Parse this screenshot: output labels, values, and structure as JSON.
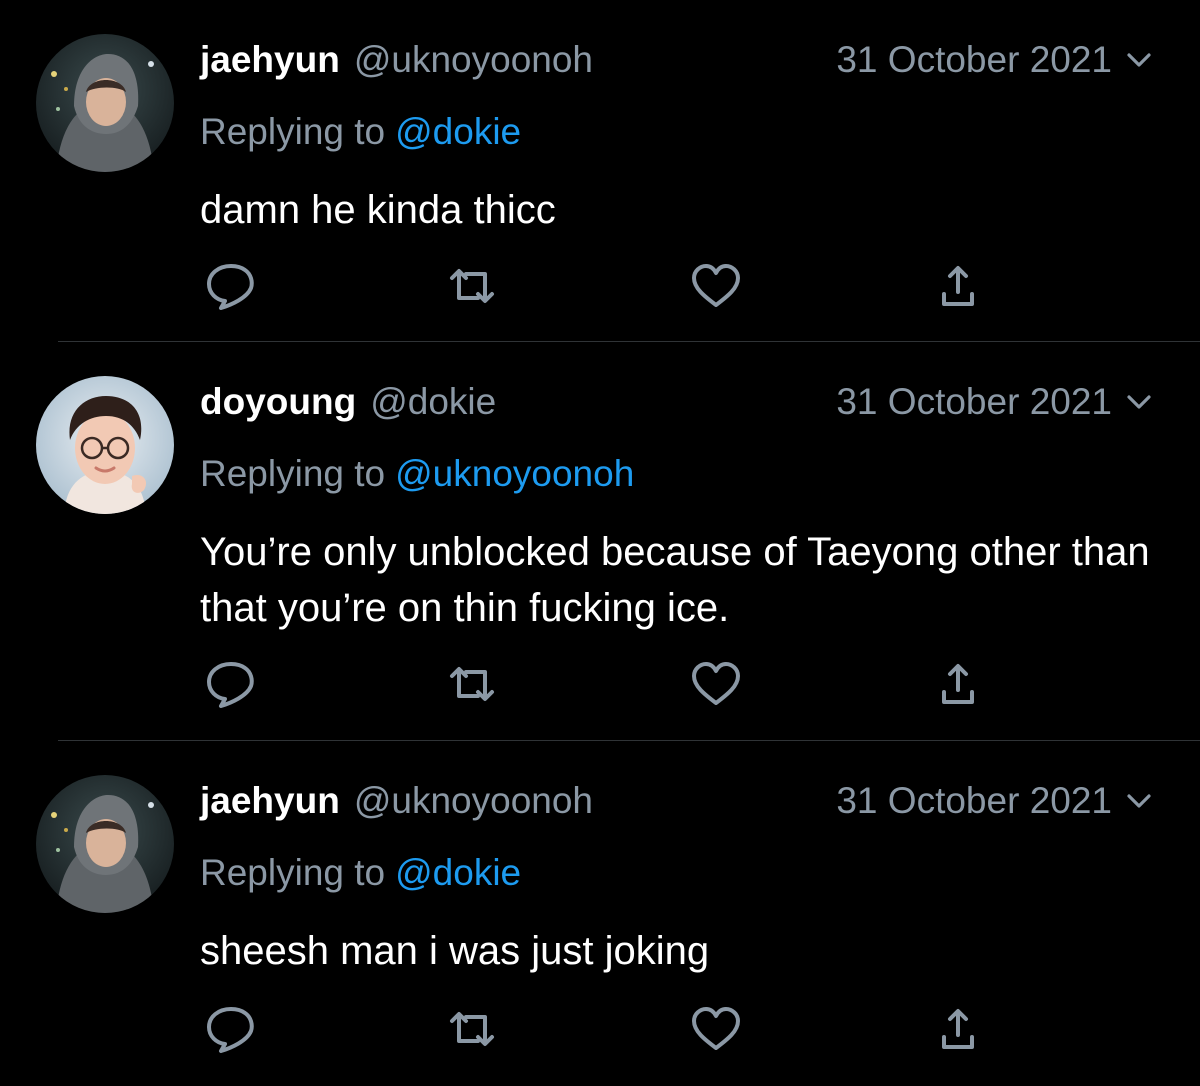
{
  "tweets": [
    {
      "display_name": "jaehyun",
      "handle": "@uknoyoonoh",
      "date": "31 October 2021",
      "reply_prefix": "Replying to",
      "reply_target": "@dokie",
      "text": "damn he kinda thicc",
      "avatar": "profile-photo-hooded"
    },
    {
      "display_name": "doyoung",
      "handle": "@dokie",
      "date": "31 October 2021",
      "reply_prefix": "Replying to",
      "reply_target": "@uknoyoonoh",
      "text": "You’re only unblocked because of Taeyong other than that you’re on thin fucking ice.",
      "avatar": "profile-photo-glasses"
    },
    {
      "display_name": "jaehyun",
      "handle": "@uknoyoonoh",
      "date": "31 October 2021",
      "reply_prefix": "Replying to",
      "reply_target": "@dokie",
      "text": "sheesh man i was just joking",
      "avatar": "profile-photo-hooded"
    }
  ],
  "actions": [
    "reply-icon",
    "retweet-icon",
    "like-icon",
    "share-icon"
  ],
  "colors": {
    "background": "#000000",
    "text": "#ffffff",
    "secondary": "#8b98a5",
    "link": "#1d9bf0",
    "divider": "#2f3336"
  }
}
